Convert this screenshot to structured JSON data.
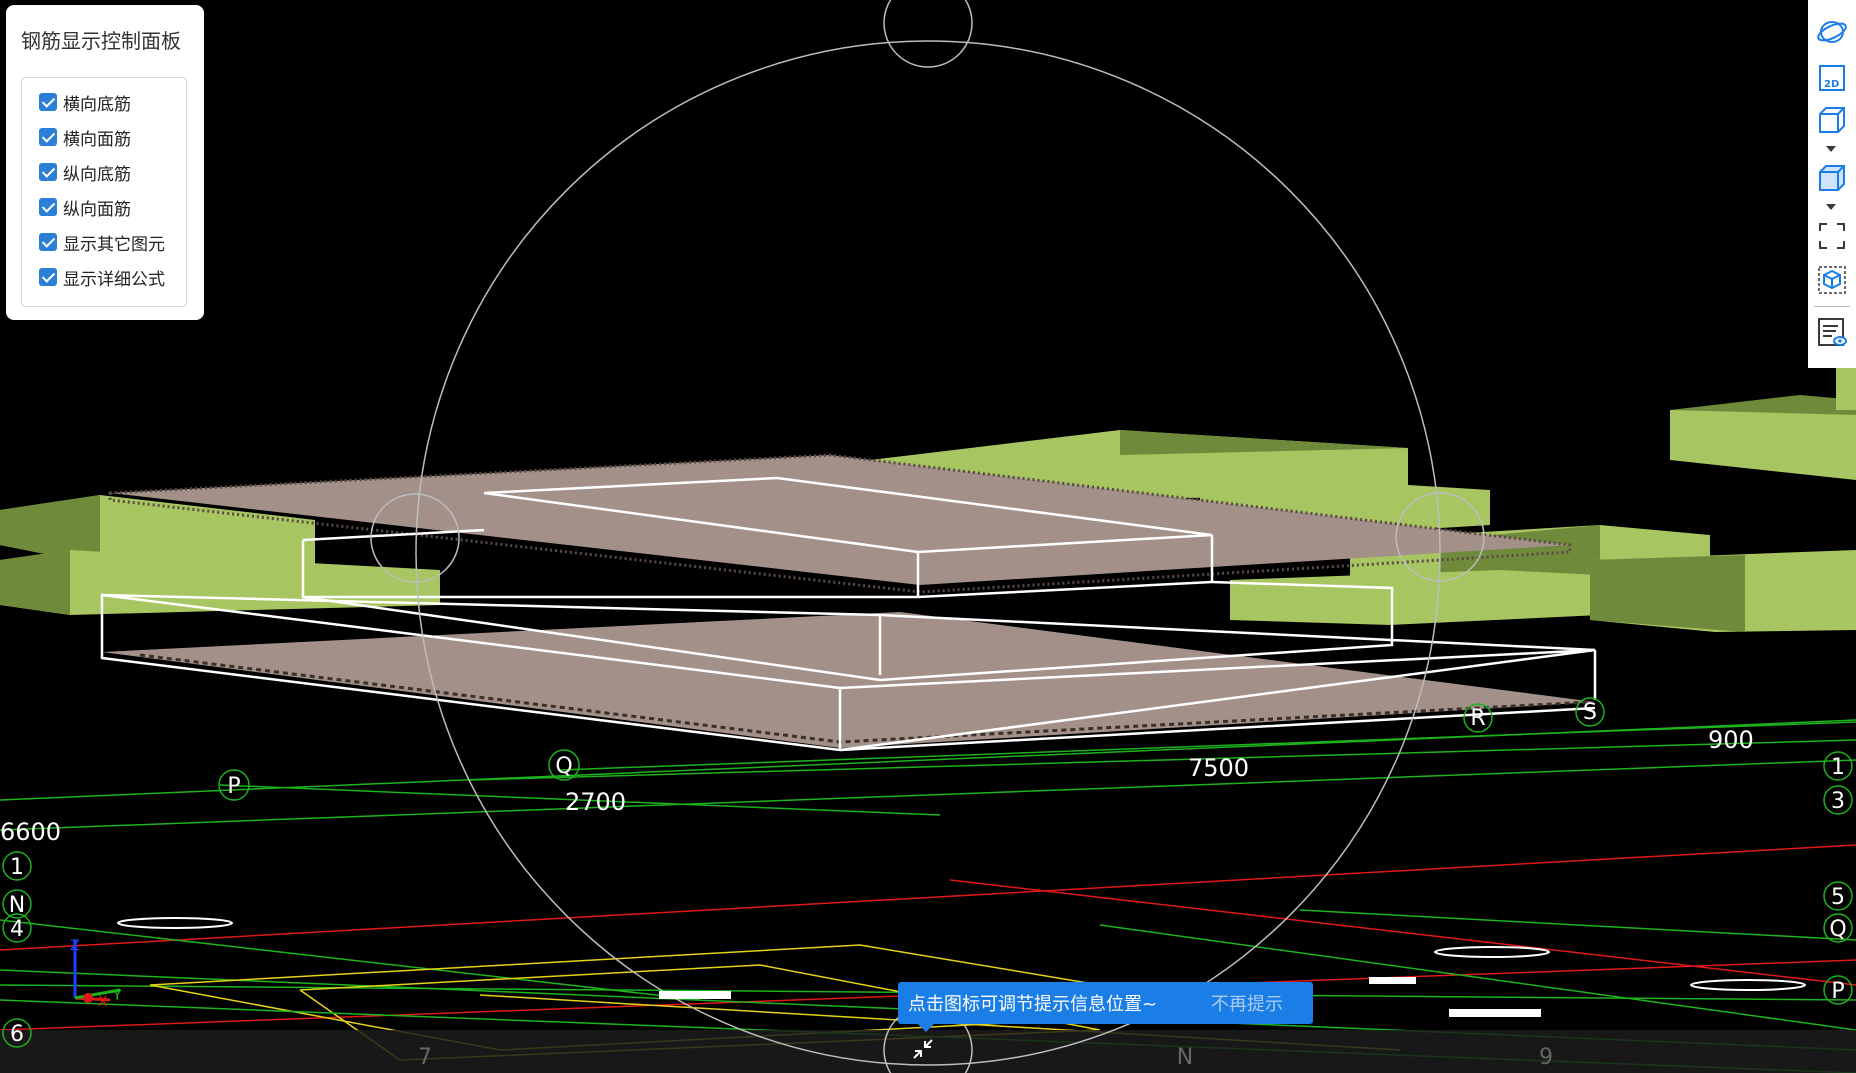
{
  "panel": {
    "title": "钢筋显示控制面板",
    "options": [
      {
        "label": "横向底筋",
        "checked": true
      },
      {
        "label": "横向面筋",
        "checked": true
      },
      {
        "label": "纵向底筋",
        "checked": true
      },
      {
        "label": "纵向面筋",
        "checked": true
      },
      {
        "label": "显示其它图元",
        "checked": true
      },
      {
        "label": "显示详细公式",
        "checked": true
      }
    ]
  },
  "toolbar": {
    "buttons": [
      "orbit-icon",
      "view-2d-icon",
      "view-3d-wireframe-icon",
      "view-3d-solid-icon",
      "fit-view-icon",
      "isometric-cube-icon",
      "property-list-icon"
    ],
    "view2d_label": "2D"
  },
  "scene": {
    "dimensions": [
      "6600",
      "2700",
      "7500",
      "900"
    ],
    "left_axis_labels": [
      "1",
      "N",
      "4",
      "6"
    ],
    "right_axis_labels": [
      "1",
      "3",
      "5",
      "Q",
      "P"
    ],
    "grid_bubbles": [
      "P",
      "Q",
      "R",
      "S"
    ],
    "bottom_labels": [
      "7",
      "N",
      "9"
    ],
    "triad": {
      "z": "Z",
      "x": "X",
      "y": "Y"
    }
  },
  "hint": {
    "text": "点击图标可调节提示信息位置~",
    "dismiss": "不再提示"
  },
  "colors": {
    "slab": "#a29089",
    "column": "#a7c560",
    "grid_green": "#1db31d",
    "grid_red": "#e01818",
    "grid_yellow": "#e5d31a",
    "accent": "#1a7ee6"
  }
}
